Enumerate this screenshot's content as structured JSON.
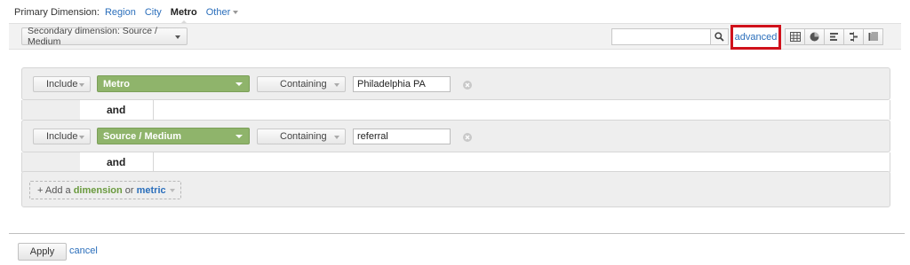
{
  "primary": {
    "label": "Primary Dimension:",
    "options": [
      "Region",
      "City"
    ],
    "active": "Metro",
    "other": "Other"
  },
  "toolbar": {
    "secondary_dimension": "Secondary dimension: Source / Medium",
    "search_placeholder": "",
    "advanced": "advanced"
  },
  "filters": [
    {
      "mode": "Include",
      "dimension": "Metro",
      "match": "Containing",
      "value": "Philadelphia PA"
    },
    {
      "mode": "Include",
      "dimension": "Source / Medium",
      "match": "Containing",
      "value": "referral"
    }
  ],
  "joiner": "and",
  "add": {
    "prefix": "+ Add a",
    "dimension": "dimension",
    "or": "or",
    "metric": "metric"
  },
  "actions": {
    "apply": "Apply",
    "cancel": "cancel"
  },
  "colors": {
    "accent_link": "#2a6ebb",
    "green": "#8fb46b",
    "highlight": "#d0111b"
  }
}
